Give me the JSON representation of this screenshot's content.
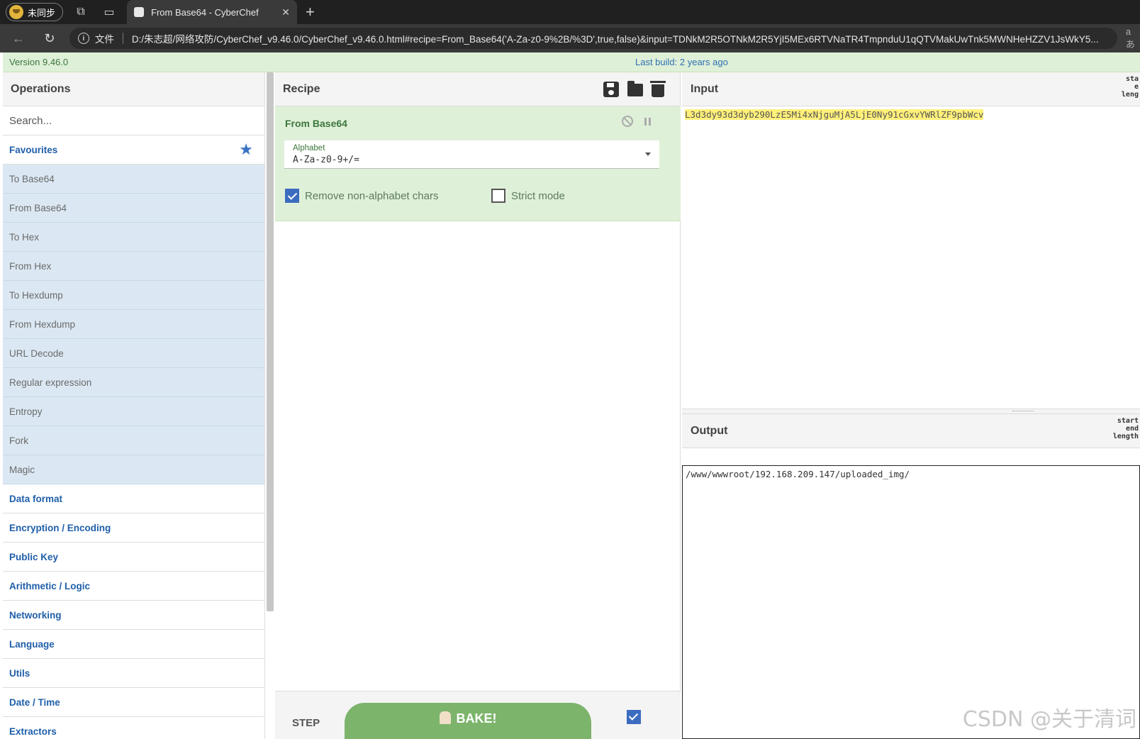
{
  "browser": {
    "profile_label": "未同步",
    "tab_title": "From Base64 - CyberChef",
    "close_glyph": "✕",
    "newtab_glyph": "+",
    "info_glyph": "i",
    "file_label": "文件",
    "url": "D:/朱志超/网络攻防/CyberChef_v9.46.0/CyberChef_v9.46.0.html#recipe=From_Base64('A-Za-z0-9%2B/%3D',true,false)&input=TDNkM2R5OTNkM2R5YjI5MEx6RTVNaTR4TmpnduU1qQTVMakUwTnk5MWNHeHZZV1JsWkY5...",
    "read_aloud": "aあ"
  },
  "banner": {
    "version": "Version 9.46.0",
    "last_build": "Last build: 2 years ago"
  },
  "operations": {
    "title": "Operations",
    "search_placeholder": "Search...",
    "favourites_label": "Favourites",
    "favourites": [
      "To Base64",
      "From Base64",
      "To Hex",
      "From Hex",
      "To Hexdump",
      "From Hexdump",
      "URL Decode",
      "Regular expression",
      "Entropy",
      "Fork",
      "Magic"
    ],
    "categories": [
      "Data format",
      "Encryption / Encoding",
      "Public Key",
      "Arithmetic / Logic",
      "Networking",
      "Language",
      "Utils",
      "Date / Time",
      "Extractors"
    ]
  },
  "recipe": {
    "title": "Recipe",
    "operation_name": "From Base64",
    "alphabet_label": "Alphabet",
    "alphabet_value": "A-Za-z0-9+/=",
    "remove_non_alphabet_label": "Remove non-alphabet chars",
    "remove_non_alphabet_checked": true,
    "strict_mode_label": "Strict mode",
    "strict_mode_checked": false,
    "step_label": "STEP",
    "bake_label": "BAKE!",
    "auto_bake_checked": true
  },
  "input": {
    "title": "Input",
    "stats": [
      "sta",
      "e",
      "leng"
    ],
    "text": "L3d3dy93d3dyb290LzE5Mi4xNjguMjA5LjE0Ny91cGxvYWRlZF9pbWcv"
  },
  "output": {
    "title": "Output",
    "stats": [
      "start",
      "end",
      "length"
    ],
    "text": "/www/wwwroot/192.168.209.147/uploaded_img/"
  },
  "watermark": "CSDN @关于清词"
}
